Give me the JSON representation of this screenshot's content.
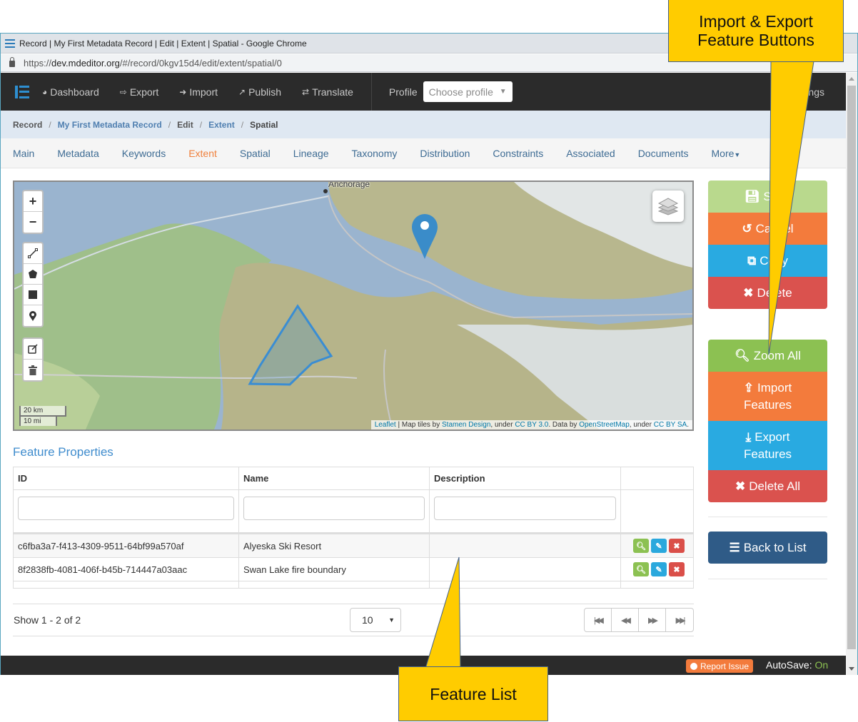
{
  "browser": {
    "title": "Record | My First Metadata Record | Edit | Extent | Spatial - Google Chrome",
    "url_scheme": "https://",
    "url_host": "dev.mdeditor.org",
    "url_path": "/#/record/0kgv15d4/edit/extent/spatial/0"
  },
  "navbar": {
    "items": [
      {
        "label": "Dashboard",
        "icon": "dashboard-icon"
      },
      {
        "label": "Export",
        "icon": "export-icon"
      },
      {
        "label": "Import",
        "icon": "import-icon"
      },
      {
        "label": "Publish",
        "icon": "publish-icon"
      },
      {
        "label": "Translate",
        "icon": "translate-icon"
      }
    ],
    "profile_label": "Profile",
    "profile_placeholder": "Choose profile",
    "settings_label": "Settings"
  },
  "breadcrumb": [
    "Record",
    "My First Metadata Record",
    "Edit",
    "Extent",
    "Spatial"
  ],
  "tabs": {
    "items": [
      "Main",
      "Metadata",
      "Keywords",
      "Extent",
      "Spatial",
      "Lineage",
      "Taxonomy",
      "Distribution",
      "Constraints",
      "Associated",
      "Documents",
      "More"
    ],
    "active": "Extent"
  },
  "map": {
    "city_label": "Anchorage",
    "scale_km": "20 km",
    "scale_mi": "10 mi",
    "attribution": {
      "leaflet": "Leaflet",
      "tiles_prefix": " | Map tiles by ",
      "stamen": "Stamen Design",
      "under1": ", under ",
      "cc_by": "CC BY 3.0",
      "data_by": ". Data by ",
      "osm": "OpenStreetMap",
      "under2": ", under ",
      "cc_by_sa": "CC BY SA",
      "end": "."
    },
    "zoom_in": "+",
    "zoom_out": "−"
  },
  "features": {
    "title": "Feature Properties",
    "columns": [
      "ID",
      "Name",
      "Description",
      ""
    ],
    "rows": [
      {
        "id": "c6fba3a7-f413-4309-9511-64bf99a570af",
        "name": "Alyeska Ski Resort",
        "description": ""
      },
      {
        "id": "8f2838fb-4081-406f-b45b-714447a03aac",
        "name": "Swan Lake fire boundary",
        "description": ""
      }
    ],
    "pager": {
      "summary": "Show 1 - 2 of 2",
      "page_size": "10"
    }
  },
  "side_buttons": {
    "save": "Save",
    "cancel": "Cancel",
    "copy": "Copy",
    "delete": "Delete",
    "zoom_all": "Zoom All",
    "import_features_1": "Import",
    "import_features_2": "Features",
    "export_features_1": "Export",
    "export_features_2": "Features",
    "delete_all": "Delete All",
    "back_to_list": "Back to List"
  },
  "footer": {
    "report_issue": "Report Issue",
    "autosave_label": "AutoSave:",
    "autosave_value": "On"
  },
  "callouts": {
    "top_line1": "Import & Export",
    "top_line2": "Feature Buttons",
    "bottom": "Feature List"
  },
  "colors": {
    "accent_orange": "#f37b3c",
    "success_green": "#8cc152",
    "info_blue": "#29aae1",
    "danger_red": "#da524e",
    "navy": "#2f5b87",
    "callout_yellow": "#ffcc00"
  }
}
